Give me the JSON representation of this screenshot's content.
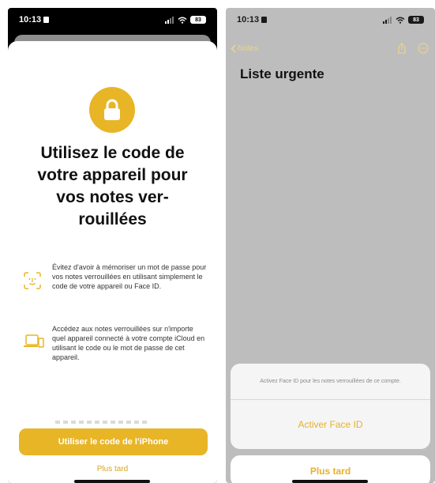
{
  "left": {
    "status": {
      "time": "10:13",
      "battery": "83"
    },
    "sheet": {
      "title": "Utilisez le code de\nvotre appareil pour\nvos notes ver-\nrouillées",
      "features": [
        {
          "icon": "face-id-icon",
          "text": "Évitez d'avoir à mémoriser un mot de passe pour vos notes verrouillées en utilisant simplement le code de votre appareil ou Face ID."
        },
        {
          "icon": "devices-icon",
          "text": "Accédez aux notes verrouillées sur n'importe quel appareil connecté à votre compte iCloud en utilisant le code ou le mot de passe de cet appareil."
        }
      ],
      "primary_button": "Utiliser le code de l'iPhone",
      "later_link": "Plus tard"
    }
  },
  "right": {
    "status": {
      "time": "10:13",
      "battery": "83"
    },
    "navbar": {
      "back_label": "Notes"
    },
    "note_title": "Liste urgente",
    "action_sheet": {
      "message": "Activez Face ID pour les notes verrouillées de ce compte.",
      "action": "Activer Face ID",
      "cancel": "Plus tard"
    }
  },
  "colors": {
    "accent": "#e8b526",
    "link": "#d7a51c",
    "dimmed_background": "#bdbdbd"
  }
}
